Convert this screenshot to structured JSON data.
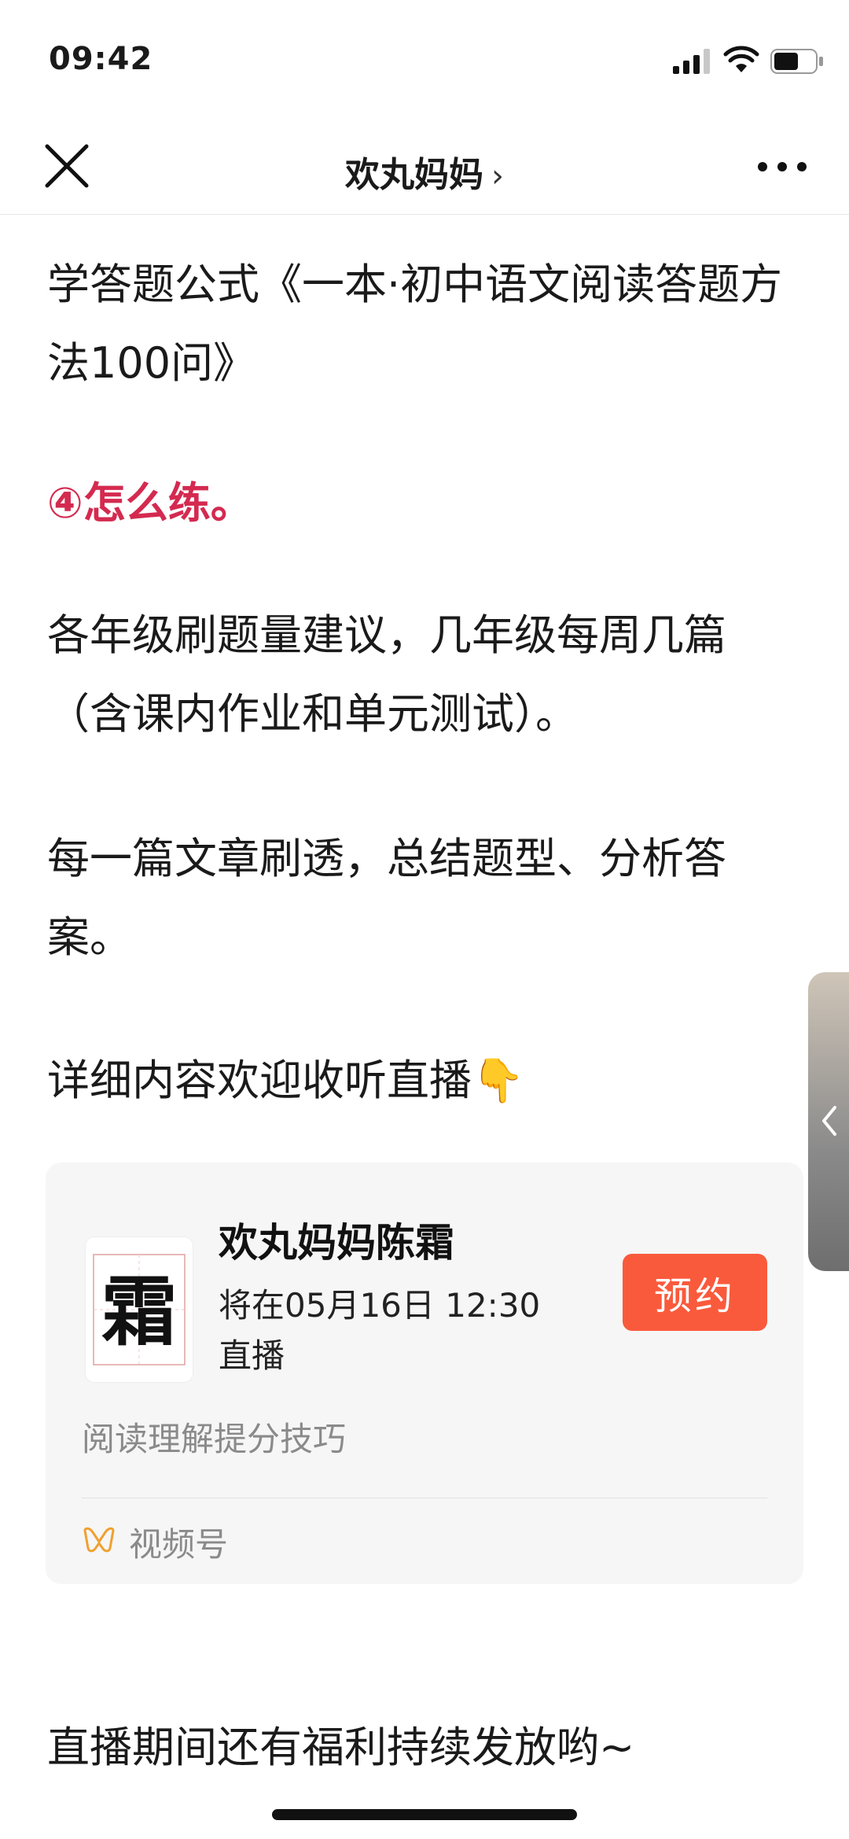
{
  "status_bar": {
    "time": "09:42",
    "icons": [
      "signal-icon",
      "wifi-icon",
      "battery-icon"
    ]
  },
  "nav": {
    "title": "欢丸妈妈",
    "chevron": "›",
    "close_icon": "close-icon",
    "more_icon": "more-icon"
  },
  "article": {
    "para1": "学答题公式《一本·初中语文阅读答题方法100问》",
    "heading4": "④怎么练。",
    "para3": "各年级刷题量建议，几年级每周几篇（含课内作业和单元测试）。",
    "para4": "每一篇文章刷透，总结题型、分析答案。",
    "para5": "详细内容欢迎收听直播",
    "para5_emoji": "👇",
    "para6": "直播期间还有福利持续发放哟~"
  },
  "live_card": {
    "avatar_char": "霜",
    "title": "欢丸妈妈陈霜",
    "time_text": "将在05月16日 12:30 直播",
    "reserve_label": "预约",
    "description": "阅读理解提分技巧",
    "channel_label": "视频号"
  },
  "colors": {
    "heading_red": "#d42a50",
    "reserve_orange": "#fa5a3c",
    "channel_icon": "#f0a030"
  }
}
